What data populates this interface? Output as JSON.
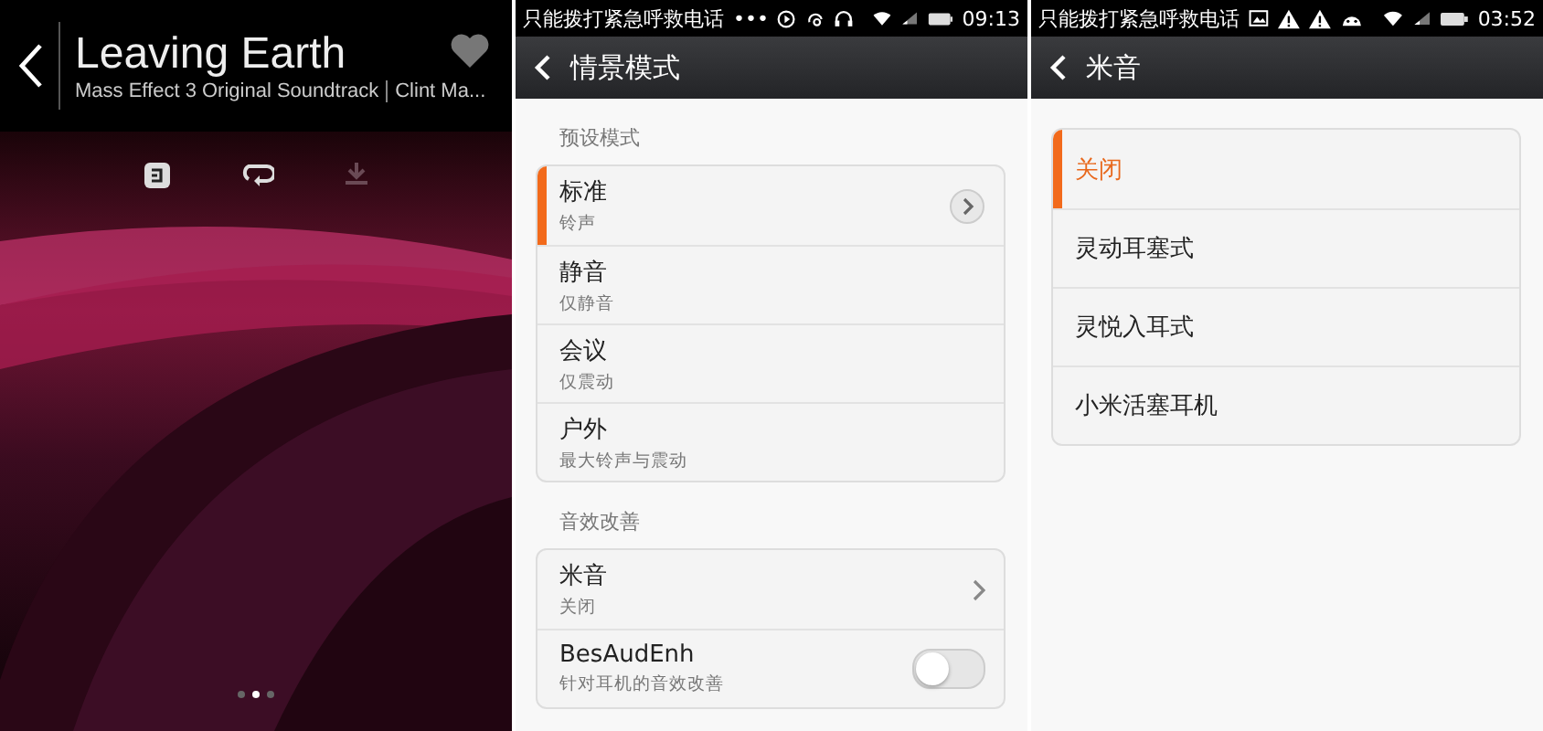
{
  "player": {
    "title": "Leaving Earth",
    "album": "Mass Effect 3 Original Soundtrack",
    "artist": "Clint Ma...",
    "favorite": false,
    "pages": [
      {
        "selected": false
      },
      {
        "selected": true
      },
      {
        "selected": false
      }
    ]
  },
  "profiles_screen": {
    "status_bar": {
      "notice": "只能拨打紧急呼救电话",
      "more": "•••",
      "time": "09:13"
    },
    "header": {
      "title": "情景模式"
    },
    "sections": [
      {
        "label": "预设模式",
        "items": [
          {
            "kind": "link",
            "title": "标准",
            "subtitle": "铃声",
            "selected": true,
            "circled": true
          },
          {
            "kind": "plain",
            "title": "静音",
            "subtitle": "仅静音",
            "selected": false
          },
          {
            "kind": "plain",
            "title": "会议",
            "subtitle": "仅震动",
            "selected": false
          },
          {
            "kind": "plain",
            "title": "户外",
            "subtitle": "最大铃声与震动",
            "selected": false
          }
        ]
      },
      {
        "label": "音效改善",
        "items": [
          {
            "kind": "link",
            "title": "米音",
            "subtitle": "关闭",
            "selected": false,
            "circled": false
          },
          {
            "kind": "toggle",
            "title": "BesAudEnh",
            "subtitle": "针对耳机的音效改善",
            "selected": false,
            "on": false
          }
        ]
      }
    ]
  },
  "miyin_screen": {
    "status_bar": {
      "notice": "只能拨打紧急呼救电话",
      "time": "03:52"
    },
    "header": {
      "title": "米音"
    },
    "options": [
      {
        "label": "关闭",
        "selected": true
      },
      {
        "label": "灵动耳塞式",
        "selected": false
      },
      {
        "label": "灵悦入耳式",
        "selected": false
      },
      {
        "label": "小米活塞耳机",
        "selected": false
      }
    ]
  }
}
